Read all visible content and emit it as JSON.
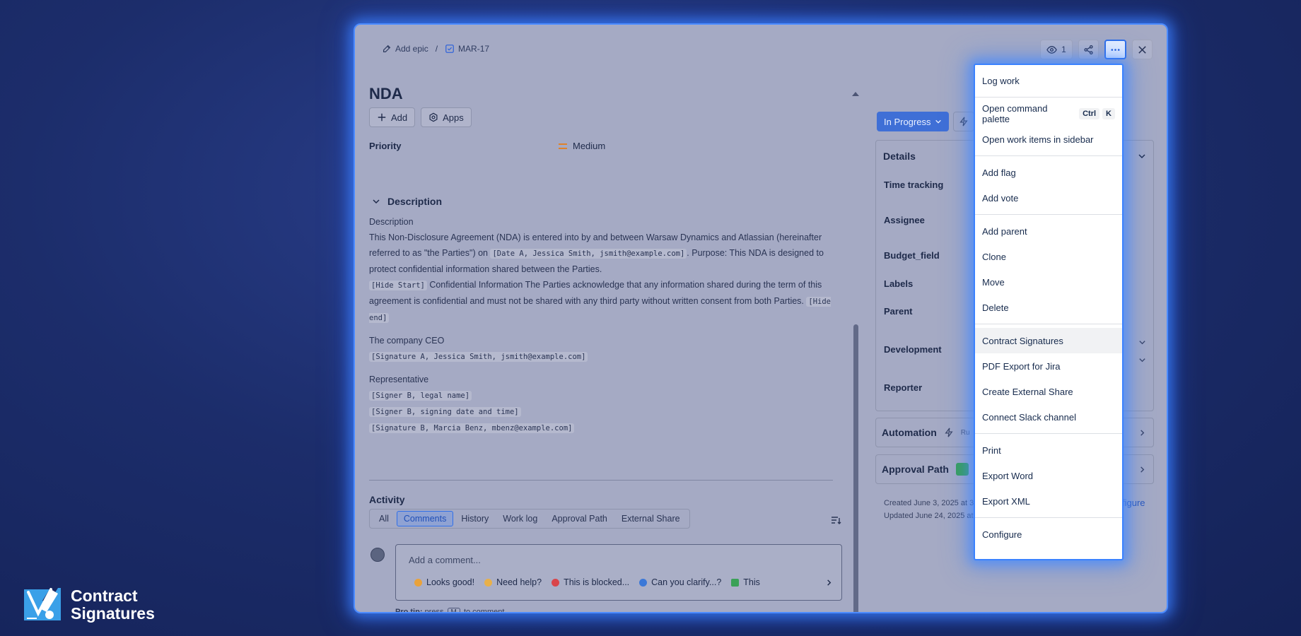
{
  "breadcrumb": {
    "epic": "Add epic",
    "sep": "/",
    "issue_key": "MAR-17"
  },
  "top_actions": {
    "watchers": "1"
  },
  "issue": {
    "title": "NDA",
    "add_label": "Add",
    "apps_label": "Apps",
    "priority_label": "Priority",
    "priority_value": "Medium"
  },
  "description": {
    "heading": "Description",
    "para1_label": "Description",
    "para1_a": "This Non-Disclosure Agreement (NDA) is entered into by and between Warsaw Dynamics and Atlassian (hereinafter referred to as \"the Parties\") on ",
    "para1_code": "[Date A, Jessica Smith, jsmith@example.com]",
    "para1_b": ". Purpose: This NDA is designed to protect confidential information shared between the Parties.",
    "para2_code1": "[Hide Start]",
    "para2_text": " Confidential Information The Parties acknowledge that any information shared during the term of this agreement is confidential and must not be shared with any third party without written consent from both Parties. ",
    "para2_code2": "[Hide end]",
    "ceo_label": "The company CEO",
    "ceo_sig": "[Signature A, Jessica Smith, jsmith@example.com]",
    "rep_label": "Representative",
    "rep_1": "[Signer B, legal name]",
    "rep_2": "[Signer B, signing date and time]",
    "rep_3": "[Signature B, Marcia Benz, mbenz@example.com]"
  },
  "activity": {
    "heading": "Activity",
    "tabs": [
      "All",
      "Comments",
      "History",
      "Work log",
      "Approval Path",
      "External Share"
    ],
    "comment_placeholder": "Add a comment...",
    "quick_replies": [
      "Looks good!",
      "Need help?",
      "This is blocked...",
      "Can you clarify...?",
      "This"
    ],
    "protip_a": "Pro tip:",
    "protip_b": "press",
    "protip_key": "M",
    "protip_c": "to comment"
  },
  "side": {
    "status": "In Progress",
    "details_heading": "Details",
    "fields": [
      "Time tracking",
      "Assignee",
      "Budget_field",
      "Labels",
      "Parent",
      "Development",
      "Reporter"
    ],
    "automation": "Automation",
    "automation_sub": "Ru",
    "approval_path": "Approval Path",
    "created": "Created June 3, 2025 at 3:5",
    "updated": "Updated June 24, 2025 at 1",
    "configure": "figure"
  },
  "menu": {
    "log_work": "Log work",
    "open_command_palette": "Open command palette",
    "kb_ctrl": "Ctrl",
    "kb_k": "K",
    "open_sidebar": "Open work items in sidebar",
    "add_flag": "Add flag",
    "add_vote": "Add vote",
    "add_parent": "Add parent",
    "clone": "Clone",
    "move": "Move",
    "delete": "Delete",
    "contract_signatures": "Contract Signatures",
    "pdf_export": "PDF Export for Jira",
    "external_share": "Create External Share",
    "slack": "Connect Slack channel",
    "print": "Print",
    "export_word": "Export Word",
    "export_xml": "Export XML",
    "configure": "Configure"
  },
  "brand": {
    "line1": "Contract",
    "line2": "Signatures"
  },
  "colors": {
    "accent": "#3b82ff",
    "status": "#3f6fd6",
    "priority": "#e0822a"
  }
}
